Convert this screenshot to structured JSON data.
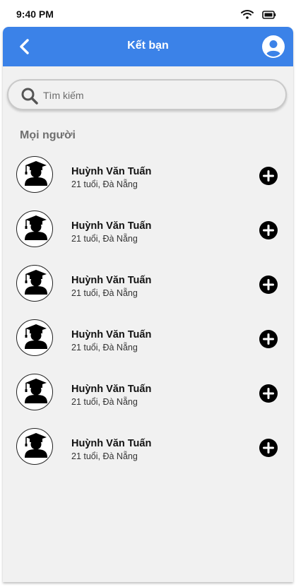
{
  "status_bar": {
    "time": "9:40 PM",
    "wifi_icon": "wifi-icon",
    "battery_icon": "battery-icon"
  },
  "header": {
    "title": "Kết bạn",
    "back_icon": "chevron-left-icon",
    "profile_icon": "user-circle-icon"
  },
  "search": {
    "placeholder": "Tìm kiếm",
    "value": "",
    "icon": "search-icon"
  },
  "section": {
    "title": "Mọi người"
  },
  "people": [
    {
      "name": "Huỳnh Văn Tuấn",
      "info": "21 tuổi, Đà Nẵng",
      "avatar_icon": "graduate-avatar-icon",
      "action_icon": "add-circle-icon"
    },
    {
      "name": "Huỳnh Văn Tuấn",
      "info": "21 tuổi, Đà Nẵng",
      "avatar_icon": "graduate-avatar-icon",
      "action_icon": "add-circle-icon"
    },
    {
      "name": "Huỳnh Văn Tuấn",
      "info": "21 tuổi, Đà Nẵng",
      "avatar_icon": "graduate-avatar-icon",
      "action_icon": "add-circle-icon"
    },
    {
      "name": "Huỳnh Văn Tuấn",
      "info": "21 tuổi, Đà Nẵng",
      "avatar_icon": "graduate-avatar-icon",
      "action_icon": "add-circle-icon"
    },
    {
      "name": "Huỳnh Văn Tuấn",
      "info": "21 tuổi, Đà Nẵng",
      "avatar_icon": "graduate-avatar-icon",
      "action_icon": "add-circle-icon"
    },
    {
      "name": "Huỳnh Văn Tuấn",
      "info": "21 tuổi, Đà Nẵng",
      "avatar_icon": "graduate-avatar-icon",
      "action_icon": "add-circle-icon"
    }
  ],
  "colors": {
    "header_bg": "#3b82e8",
    "screen_bg": "#f1f1f1",
    "accent_text": "#ffffff"
  }
}
